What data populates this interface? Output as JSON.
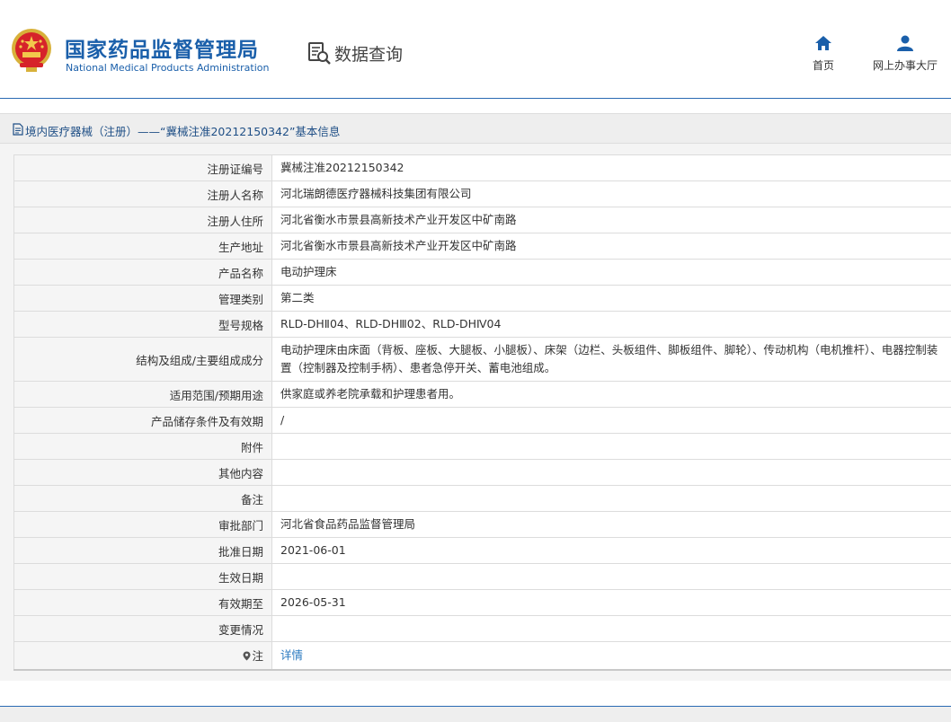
{
  "header": {
    "title_cn": "国家药品监督管理局",
    "title_en": "National Medical Products Administration",
    "query_label": "数据查询",
    "nav": [
      {
        "label": "首页",
        "icon": "home-icon"
      },
      {
        "label": "网上办事大厅",
        "icon": "user-icon"
      }
    ]
  },
  "breadcrumb": "境内医疗器械（注册）——“冀械注准20212150342”基本信息",
  "rows": [
    {
      "label": "注册证编号",
      "value": "冀械注准20212150342"
    },
    {
      "label": "注册人名称",
      "value": "河北瑞朗德医疗器械科技集团有限公司"
    },
    {
      "label": "注册人住所",
      "value": "河北省衡水市景县高新技术产业开发区中矿南路"
    },
    {
      "label": "生产地址",
      "value": "河北省衡水市景县高新技术产业开发区中矿南路"
    },
    {
      "label": "产品名称",
      "value": "电动护理床"
    },
    {
      "label": "管理类别",
      "value": "第二类"
    },
    {
      "label": "型号规格",
      "value": "RLD-DHⅡ04、RLD-DHⅢ02、RLD-DHⅣ04"
    },
    {
      "label": "结构及组成/主要组成成分",
      "value": "电动护理床由床面（背板、座板、大腿板、小腿板）、床架（边栏、头板组件、脚板组件、脚轮）、传动机构（电机推杆）、电器控制装置（控制器及控制手柄）、患者急停开关、蓄电池组成。"
    },
    {
      "label": "适用范围/预期用途",
      "value": "供家庭或养老院承载和护理患者用。"
    },
    {
      "label": "产品储存条件及有效期",
      "value": "/"
    },
    {
      "label": "附件",
      "value": ""
    },
    {
      "label": "其他内容",
      "value": ""
    },
    {
      "label": "备注",
      "value": ""
    },
    {
      "label": "审批部门",
      "value": "河北省食品药品监督管理局"
    },
    {
      "label": "批准日期",
      "value": "2021-06-01"
    },
    {
      "label": "生效日期",
      "value": ""
    },
    {
      "label": "有效期至",
      "value": "2026-05-31"
    },
    {
      "label": "变更情况",
      "value": ""
    }
  ],
  "note": {
    "label": "注",
    "link": "详情"
  },
  "colors": {
    "brand": "#1a5faa",
    "link": "#2a7ac0",
    "label_bg": "#f5f5f5"
  }
}
